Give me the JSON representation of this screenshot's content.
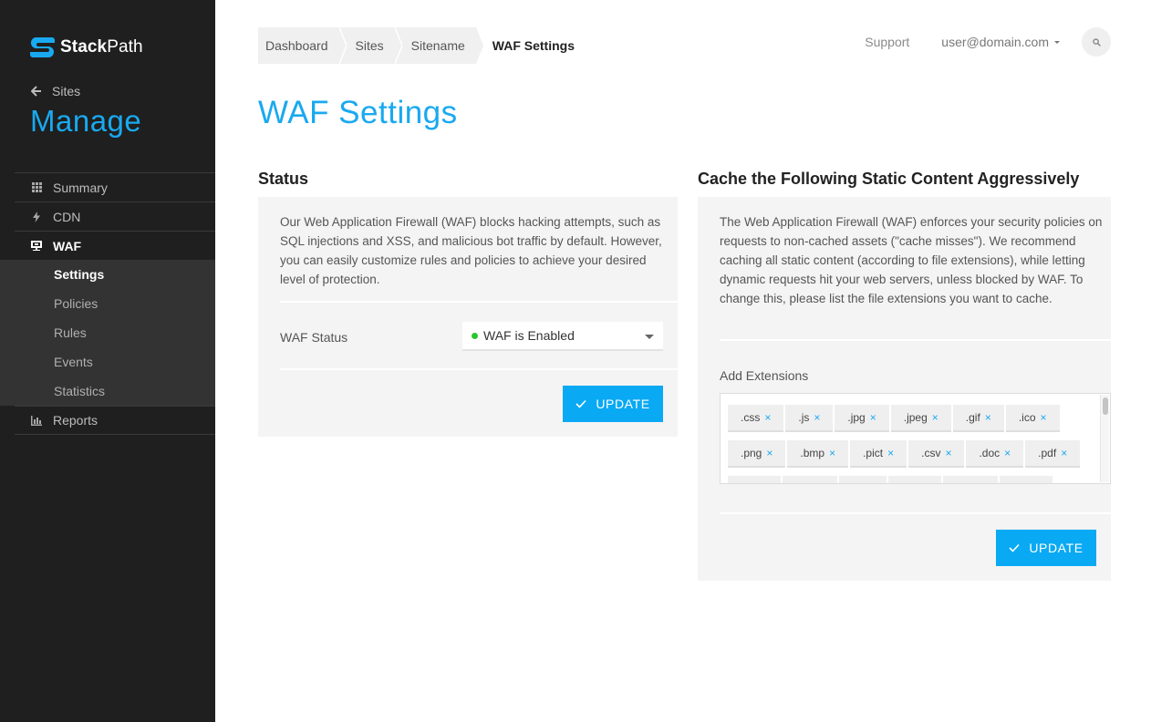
{
  "brand": {
    "name_bold": "Stack",
    "name_rest": "Path",
    "accent": "#19a9f0"
  },
  "sidebar": {
    "back_label": "Sites",
    "title": "Manage",
    "items": [
      {
        "label": "Summary",
        "icon": "grid-icon"
      },
      {
        "label": "CDN",
        "icon": "lightning-icon"
      },
      {
        "label": "WAF",
        "icon": "waf-shield-icon",
        "active": true
      },
      {
        "label": "Reports",
        "icon": "bar-chart-icon"
      }
    ],
    "waf_subitems": [
      {
        "label": "Settings",
        "active": true
      },
      {
        "label": "Policies"
      },
      {
        "label": "Rules"
      },
      {
        "label": "Events"
      },
      {
        "label": "Statistics"
      }
    ]
  },
  "header": {
    "breadcrumb": [
      "Dashboard",
      "Sites",
      "Sitename",
      "WAF Settings"
    ],
    "support_label": "Support",
    "user_label": "user@domain.com",
    "search_icon": "search-icon"
  },
  "page": {
    "title": "WAF Settings"
  },
  "status_panel": {
    "heading": "Status",
    "description": "Our Web Application Firewall (WAF) blocks hacking attempts, such as SQL injections and XSS, and malicious bot traffic by default. However, you can easily customize rules and policies to achieve your desired level of protection.",
    "field_label": "WAF Status",
    "select_value": "WAF is Enabled",
    "status_color": "#2bc52e",
    "button_label": "UPDATE"
  },
  "cache_panel": {
    "heading": "Cache the Following Static Content Aggressively",
    "description": "The Web Application Firewall (WAF) enforces your security policies on requests to non-cached assets (\"cache misses\"). We recommend caching all static content (according to file extensions), while letting dynamic requests hit your web servers, unless blocked by WAF. To change this, please list the file extensions you want to cache.",
    "field_label": "Add Extensions",
    "tags": [
      ".css",
      ".js",
      ".jpg",
      ".jpeg",
      ".gif",
      ".ico",
      ".png",
      ".bmp",
      ".pict",
      ".csv",
      ".doc",
      ".pdf"
    ],
    "button_label": "UPDATE"
  }
}
